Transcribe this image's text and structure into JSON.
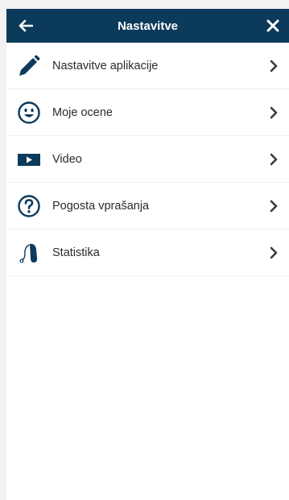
{
  "header": {
    "title": "Nastavitve",
    "back_icon": "arrow-left-icon",
    "close_icon": "close-icon",
    "background": "#0c3a5b"
  },
  "menu": {
    "items": [
      {
        "label": "Nastavitve aplikacije",
        "icon": "pencil-icon"
      },
      {
        "label": "Moje ocene",
        "icon": "smiley-icon"
      },
      {
        "label": "Video",
        "icon": "video-play-icon"
      },
      {
        "label": "Pogosta vprašanja",
        "icon": "question-circle-icon"
      },
      {
        "label": "Statistika",
        "icon": "hearing-aid-icon"
      }
    ]
  },
  "colors": {
    "icon": "#0c3a5b",
    "text": "#2b2b2b",
    "chevron": "#3a3a3a"
  }
}
